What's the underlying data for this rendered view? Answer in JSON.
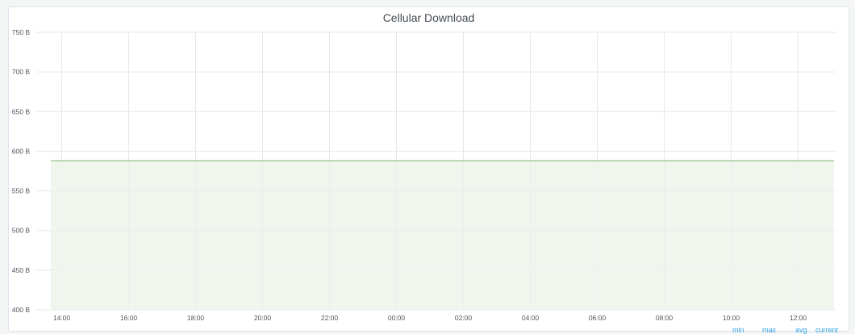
{
  "panel": {
    "title": "Cellular Download"
  },
  "legend": {
    "columns": [
      "min",
      "max",
      "avg",
      "current"
    ]
  },
  "colors": {
    "line": "#7eb26d",
    "fill": "#f0f6ee",
    "grid": "#e5e7ea",
    "axis_text": "#52545c",
    "legend_header": "#33a2e5"
  },
  "chart_data": {
    "type": "area",
    "title": "Cellular Download",
    "xlabel": "",
    "ylabel": "",
    "x_ticks": [
      "14:00",
      "16:00",
      "18:00",
      "20:00",
      "22:00",
      "00:00",
      "02:00",
      "04:00",
      "06:00",
      "08:00",
      "10:00",
      "12:00"
    ],
    "y_ticks": [
      "400 B",
      "450 B",
      "500 B",
      "550 B",
      "600 B",
      "650 B",
      "700 B",
      "750 B"
    ],
    "y_tick_values": [
      400,
      450,
      500,
      550,
      600,
      650,
      700,
      750
    ],
    "ylim": [
      400,
      750
    ],
    "x_hours_range": [
      "13:40",
      "13:10"
    ],
    "series": [
      {
        "values": [
          588,
          588
        ]
      }
    ],
    "grid": true,
    "legend_placement": "bottom-right"
  }
}
